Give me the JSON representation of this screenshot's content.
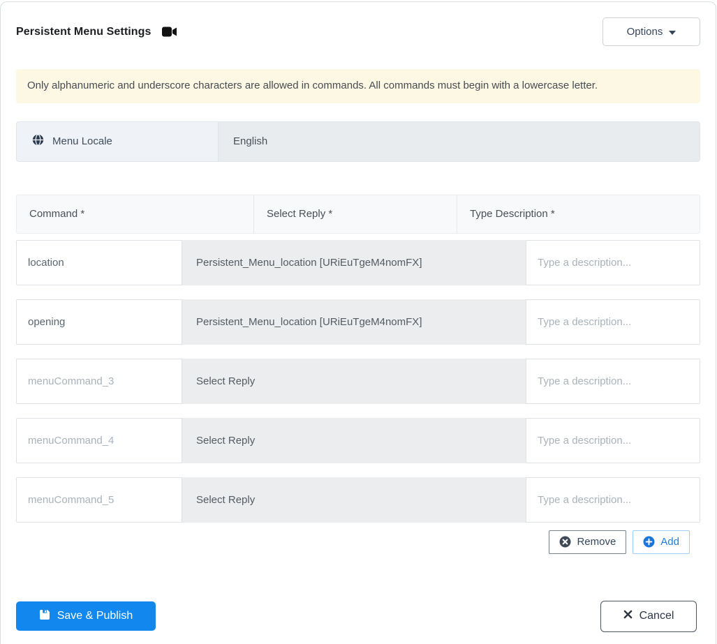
{
  "colors": {
    "primary": "#1287ee",
    "alert-bg": "#fdf8e3",
    "select-bg": "#ebedee",
    "header-bg": "#f8f9fa",
    "locale-label-bg": "#eff2f7"
  },
  "header": {
    "title": "Persistent Menu Settings",
    "title_icon": "video-camera",
    "options_label": "Options"
  },
  "alert": {
    "text": "Only alphanumeric and underscore characters are allowed in commands. All commands must begin with a lowercase letter."
  },
  "locale": {
    "icon": "globe",
    "label": "Menu Locale",
    "value": "English"
  },
  "table": {
    "headers": [
      "Command *",
      "Select Reply *",
      "Type Description *"
    ],
    "rows": [
      {
        "command_value": "location",
        "reply": "Persistent_Menu_location [URiEuTgeM4nomFX]",
        "description_placeholder": "Type a description..."
      },
      {
        "command_value": "opening",
        "reply": "Persistent_Menu_location [URiEuTgeM4nomFX]",
        "description_placeholder": "Type a description..."
      },
      {
        "command_placeholder": "menuCommand_3",
        "reply": "Select Reply",
        "description_placeholder": "Type a description..."
      },
      {
        "command_placeholder": "menuCommand_4",
        "reply": "Select Reply",
        "description_placeholder": "Type a description..."
      },
      {
        "command_placeholder": "menuCommand_5",
        "reply": "Select Reply",
        "description_placeholder": "Type a description..."
      }
    ]
  },
  "actions": {
    "remove_label": "Remove",
    "add_label": "Add"
  },
  "footer": {
    "save_label": "Save & Publish",
    "cancel_label": "Cancel"
  }
}
